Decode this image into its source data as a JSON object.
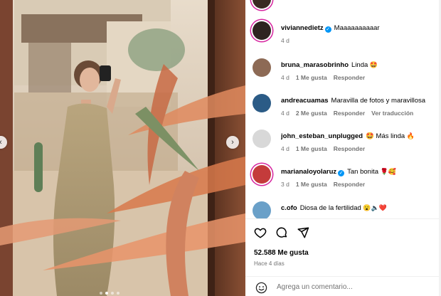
{
  "post": {
    "likes": "52.588 Me gusta",
    "posted_ago": "Hace 4 días",
    "add_comment_placeholder": "Agrega un comentario..."
  },
  "caption": {
    "username": "viviannedietz",
    "verified": true,
    "text": "Maaaaaaaaaar",
    "age": "4 d"
  },
  "comments": [
    {
      "username": "bruna_marasobrinho",
      "verified": false,
      "text": "Linda",
      "emoji": "🤩",
      "age": "4 d",
      "likes": "1 Me gusta",
      "reply": "Responder",
      "translation": ""
    },
    {
      "username": "andreacuamas",
      "verified": false,
      "text": "Maravilla de fotos y maravillosa",
      "emoji": "",
      "age": "4 d",
      "likes": "2 Me gusta",
      "reply": "Responder",
      "translation": "Ver traducción"
    },
    {
      "username": "john_esteban_unplugged",
      "verified": false,
      "text": "Más linda",
      "emoji": "🔥",
      "emoji_prefix": "🤩",
      "age": "4 d",
      "likes": "1 Me gusta",
      "reply": "Responder",
      "translation": ""
    },
    {
      "username": "marianaloyolaruz",
      "verified": true,
      "text": "Tan bonita",
      "emoji": "🌹🥰",
      "age": "3 d",
      "likes": "1 Me gusta",
      "reply": "Responder",
      "translation": ""
    },
    {
      "username": "c.ofo",
      "verified": false,
      "text": "Diosa de la fertilidad",
      "emoji": "😮🔈❤️",
      "age": "",
      "likes": "",
      "reply": "",
      "translation": ""
    }
  ],
  "icons": {
    "like": "heart-icon",
    "comment": "comment-icon",
    "share": "share-icon",
    "emoji": "smile-icon",
    "prev": "chevron-left-icon",
    "next": "chevron-right-icon"
  },
  "colors": {
    "story_ring": "#d6249f",
    "verified": "#0095f6",
    "meta_text": "#737373"
  }
}
